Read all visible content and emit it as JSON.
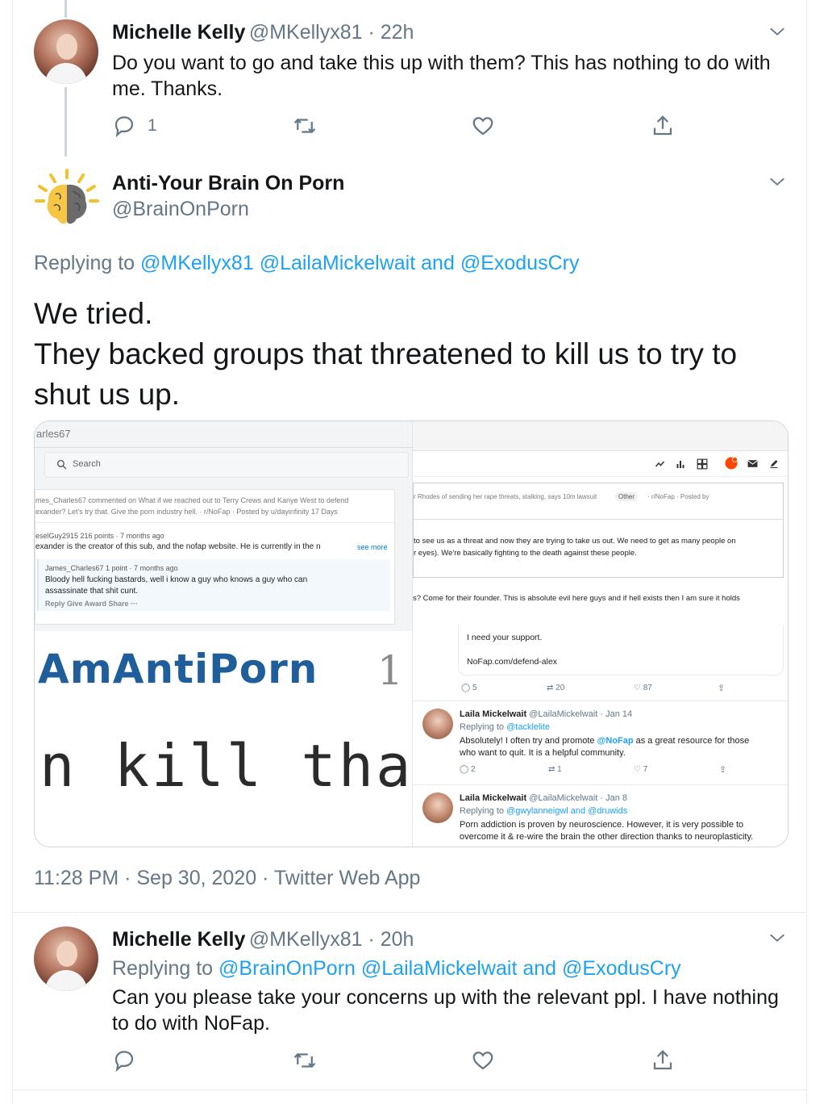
{
  "tweet1": {
    "name": "Michelle Kelly",
    "handle": "@MKellyx81 · 22h",
    "text": "Do you want to go and take this up with them? This has nothing to do with me. Thanks.",
    "reply_count": "1"
  },
  "tweet2": {
    "name": "Anti-Your Brain On Porn",
    "handle": "@BrainOnPorn",
    "replying_label": "Replying to",
    "replying_users": [
      "@MKellyx81",
      "@LailaMickelwait",
      "and",
      "@ExodusCry"
    ],
    "text_line1": "We tried.",
    "text_line2": "They backed groups that threatened to kill us to try to shut us up.",
    "timestamp": "11:28 PM · Sep 30, 2020 · Twitter Web App"
  },
  "media": {
    "left": {
      "username_fragment": "arles67",
      "search_placeholder": "Search",
      "comment1_header": "mes_Charles67 commented on What if we reached out to Terry Crews and Kanye West to defend",
      "comment1_sub": "exander? Let's try that. Give the porn industry hell. · r/NoFap · Posted by u/dayinfinity 17 Days",
      "comment2_header": "eselGuy2915 216 points · 7 months ago",
      "comment2_text": "exander is the creator of this sub, and the nofap website. He is currently in the n",
      "see_more": "see more",
      "reply_user": "James_Charles67 1 point · 7 months ago",
      "reply_text1": "Bloody hell fucking bastards, well i know a guy who knows a guy who can",
      "reply_text2": "assassinate that shit cunt.",
      "reply_actions": "Reply  Give Award  Share  ···",
      "banner": "AmAntiPorn",
      "banner_num": "1",
      "kill_text": "n kill that b"
    },
    "right": {
      "header_text": "r Rhodes of sending her rape threats, stalking, says 10m lawsuit",
      "header_tag": "Other",
      "header_sub": "· r/NoFap · Posted by",
      "para1_line1": "to see us as a threat and now they are trying to take us out. We need to get as many people on",
      "para1_line2": "r eyes). We're basically fighting to the death against these people.",
      "para2": "s? Come for their founder. This is absolute evil here guys and if hell exists then I am sure it holds",
      "quote_line1": "I need your support.",
      "quote_line2": "NoFap.com/defend-alex",
      "quote_counts": [
        "5",
        "20",
        "87"
      ],
      "t1_name": "Laila Mickelwait",
      "t1_handle": "@LailaMickelwait · Jan 14",
      "t1_replying": "Replying to",
      "t1_replying_user": "@tacklelite",
      "t1_text1_a": "Absolutely! I often try and promote",
      "t1_text1_b": "@NoFap",
      "t1_text1_c": "as a great resource for those",
      "t1_text2": "who want to quit. It is a helpful community.",
      "t1_counts": [
        "2",
        "1",
        "7"
      ],
      "t2_name": "Laila Mickelwait",
      "t2_handle": "@LailaMickelwait · Jan 8",
      "t2_replying": "Replying to",
      "t2_replying_user": "@gwylanneigwl and @druwids",
      "t2_text1": "Porn addiction is proven by neuroscience. However, it is very possible to",
      "t2_text2": "overcome it & re-wire the brain the other direction thanks to neuroplasticity."
    }
  },
  "tweet3": {
    "name": "Michelle Kelly",
    "handle": "@MKellyx81 · 20h",
    "replying_label": "Replying to",
    "replying_users": [
      "@BrainOnPorn",
      "@LailaMickelwait",
      "and",
      "@ExodusCry"
    ],
    "text": "Can you please take your concerns up with the relevant ppl. I have nothing to do with NoFap."
  },
  "colors": {
    "accent": "#1da1f2",
    "muted": "#657786",
    "text": "#14171a",
    "border": "#e6ecf0"
  }
}
